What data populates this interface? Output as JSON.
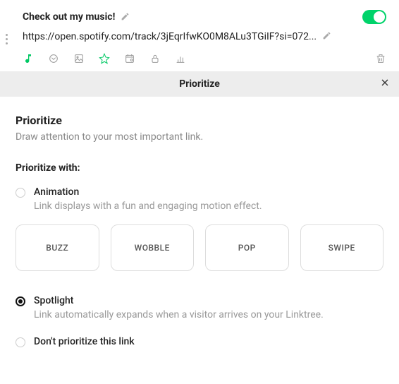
{
  "link": {
    "title": "Check out my music!",
    "url": "https://open.spotify.com/track/3jEqrIfwKO0M8ALu3TGiIF?si=072...",
    "enabled": true
  },
  "banner": {
    "title": "Prioritize"
  },
  "prioritize": {
    "title": "Prioritize",
    "subtitle": "Draw attention to your most important link.",
    "with_label": "Prioritize with:",
    "animation": {
      "label": "Animation",
      "desc": "Link displays with a fun and engaging motion effect.",
      "options": [
        "BUZZ",
        "WOBBLE",
        "POP",
        "SWIPE"
      ]
    },
    "spotlight": {
      "label": "Spotlight",
      "desc": "Link automatically expands when a visitor arrives on your Linktree."
    },
    "none": {
      "label": "Don't prioritize this link"
    }
  }
}
